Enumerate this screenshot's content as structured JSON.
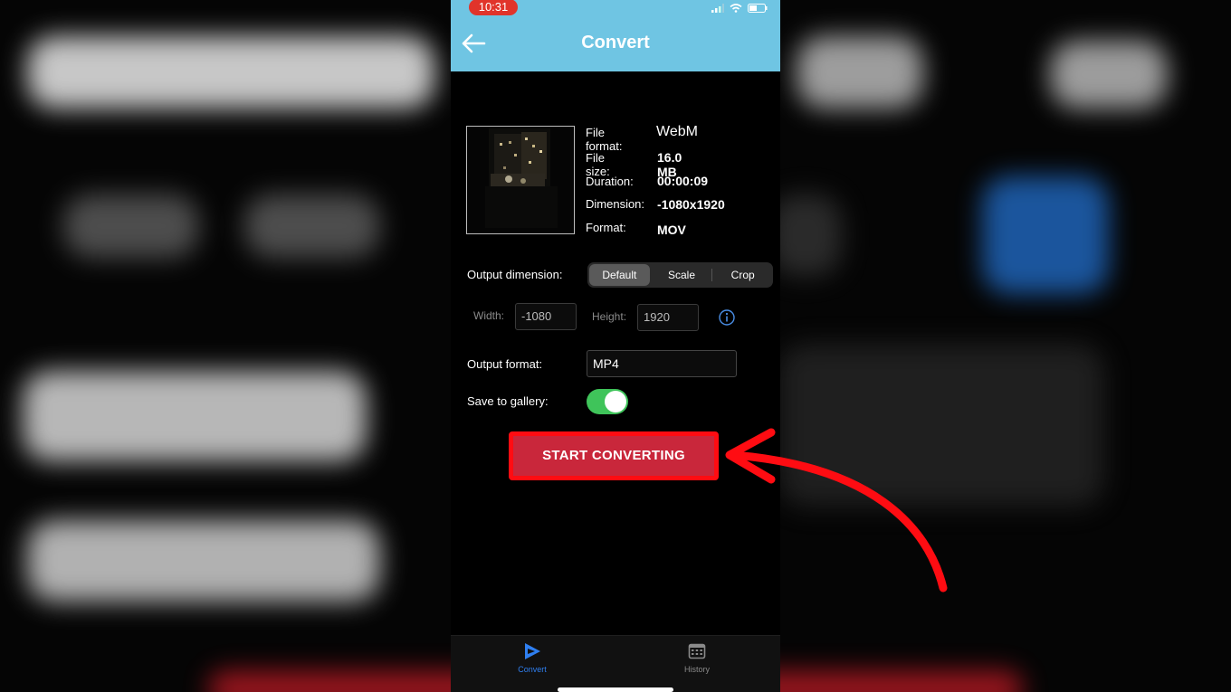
{
  "status_bar": {
    "time": "10:31"
  },
  "header": {
    "title": "Convert",
    "back_icon": "back-arrow-icon"
  },
  "file_info": {
    "file_format_label": "File format:",
    "file_format_value": "WebM",
    "file_size_label": "File size:",
    "file_size_value": "16.0 MB",
    "duration_label": "Duration:",
    "duration_value": "00:00:09",
    "dimension_label": "Dimension:",
    "dimension_value": "-1080x1920",
    "format_label": "Format:",
    "format_value": "MOV"
  },
  "output_dimension": {
    "label": "Output dimension:",
    "options": [
      "Default",
      "Scale",
      "Crop"
    ],
    "selected": "Default"
  },
  "size": {
    "width_label": "Width:",
    "width_value": "-1080",
    "height_label": "Height:",
    "height_value": "1920"
  },
  "output_format": {
    "label": "Output format:",
    "value": "MP4"
  },
  "save_to_gallery": {
    "label": "Save to gallery:",
    "enabled": true
  },
  "start_button": {
    "label": "START CONVERTING"
  },
  "tabs": [
    {
      "label": "Convert",
      "icon": "convert-play-icon",
      "active": true
    },
    {
      "label": "History",
      "icon": "calendar-icon",
      "active": false
    }
  ],
  "colors": {
    "header_bg": "#6fc5e3",
    "accent": "#2f7ff0",
    "toggle_on": "#3fc45a",
    "button_bg": "#c9273b",
    "highlight_red": "#ff0c12"
  }
}
